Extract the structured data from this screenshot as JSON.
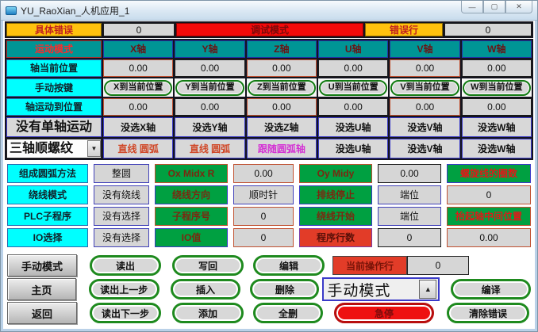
{
  "window": {
    "title": "YU_RaoXian_人机应用_1"
  },
  "icons": {
    "minimize": "—",
    "maximize": "▢",
    "close": "✕",
    "dropdown": "▼",
    "dropup": "▲"
  },
  "colors": {
    "teal": "#009595",
    "cyan": "#00FFFF",
    "green": "#00A041",
    "red": "#EE1111",
    "yellow": "#FFC20E"
  },
  "status": {
    "error_label": "具体错误",
    "error_value": "0",
    "mode_banner": "调试模式",
    "line_label": "错误行",
    "line_value": "0"
  },
  "axis": {
    "mode_label": "运动模式",
    "headers": [
      "X轴",
      "Y轴",
      "Z轴",
      "U轴",
      "V轴",
      "W轴"
    ],
    "current_label": "轴当前位置",
    "current": [
      "0.00",
      "0.00",
      "0.00",
      "0.00",
      "0.00",
      "0.00"
    ],
    "manual_label": "手动按键",
    "manual": [
      "X到当前位置",
      "Y到当前位置",
      "Z到当前位置",
      "U到当前位置",
      "V到当前位置",
      "W到当前位置"
    ],
    "target_label": "轴运动到位置",
    "target": [
      "0.00",
      "0.00",
      "0.00",
      "0.00",
      "0.00",
      "0.00"
    ],
    "single_label": "没有单轴运动",
    "single": [
      "没选X轴",
      "没选Y轴",
      "没选Z轴",
      "没选U轴",
      "没选V轴",
      "没选W轴"
    ],
    "thread_select": "三轴顺螺纹",
    "thread": [
      "直线 圆弧",
      "直线 圆弧",
      "跟随圆弧轴",
      "没选U轴",
      "没选V轴",
      "没选W轴"
    ]
  },
  "params": {
    "r1": [
      "组成圆弧方法",
      "整圆",
      "Ox Midx R",
      "0.00",
      "Oy Midy",
      "0.00",
      "螺旋线的圈数"
    ],
    "r2": [
      "绕线模式",
      "没有绕线",
      "绕线方向",
      "顺时针",
      "排线停止",
      "端位",
      "0"
    ],
    "r3": [
      "PLC子程序",
      "没有选择",
      "子程序号",
      "0",
      "绕线开始",
      "端位",
      "抬起轴中间位置"
    ],
    "r4": [
      "IO选择",
      "没有选择",
      "IO值",
      "0",
      "程序行数",
      "0",
      "0.00"
    ]
  },
  "actions": {
    "nav": [
      "手动模式",
      "主页",
      "返回"
    ],
    "row1": [
      "读出",
      "写回",
      "编辑"
    ],
    "current_line_label": "当前操作行",
    "current_line_value": "0",
    "row2": [
      "读出上一步",
      "插入",
      "删除"
    ],
    "mode_combo": "手动模式",
    "compile": "编译",
    "row3": [
      "读出下一步",
      "添加",
      "全删"
    ],
    "estop": "急停",
    "clear_error": "清除错误"
  }
}
